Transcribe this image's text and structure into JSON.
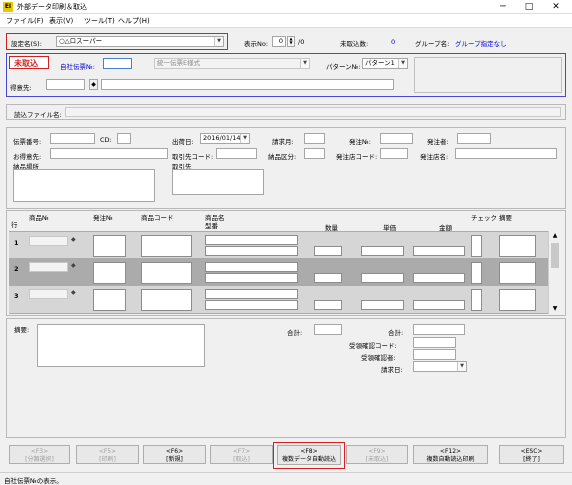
{
  "window": {
    "title": "外部データ印刷＆取込",
    "app_icon": "EI",
    "controls": [
      "─",
      "□",
      "✕"
    ]
  },
  "menu": [
    "ファイル(F)",
    "表示(V)",
    "ツール(T)",
    "ヘルプ(H)"
  ],
  "header": {
    "setting_label": "設定名(S):",
    "setting_value": "○△ロスーパー",
    "display_no_label": "表示No:",
    "display_no_value": "0",
    "display_no_total": "/0",
    "not_imported_label": "未取込数:",
    "not_imported_value": "0",
    "group_label": "グループ名:",
    "group_value": "グループ指定なし"
  },
  "upper": {
    "status_badge": "未取込",
    "slip_no_label": "自社伝票№:",
    "slip_no_value": "",
    "slip_format": "統一伝票E様式",
    "pattern_label": "パターン№:",
    "pattern_value": "パターン1",
    "customer_label": "得意先:"
  },
  "file_label": "読込ファイル名:",
  "form": {
    "slip_number": "伝票番号:",
    "cd": "CD:",
    "ship_date_label": "出荷日:",
    "ship_date_value": "2016/01/14",
    "billing_month": "請求月:",
    "order_no": "発注№:",
    "orderer": "発注者:",
    "customer2": "お得意先:",
    "trade_code": "取引先コード:",
    "delivery_class": "納品区分:",
    "order_store_code": "発注店コード:",
    "order_store_name": "発注店名:",
    "delivery_place": "納品場所",
    "trade_partner": "取引先"
  },
  "grid": {
    "row_header": "行",
    "headers": {
      "product_no": "商品№",
      "order_no": "発注№",
      "product_code": "商品コード",
      "product_name": "商品名",
      "model": "型番",
      "quantity": "数量",
      "unit_price": "単価",
      "amount": "金額",
      "check": "チェック",
      "remarks": "摘要"
    },
    "rows": [
      "1",
      "2",
      "3"
    ]
  },
  "bottom": {
    "remarks_label": "摘要:",
    "total_label": "合計:",
    "total2_label": "合計:",
    "confirm_code_label": "受領確認コード:",
    "confirmer_label": "受領確認者:",
    "billing_date_label": "請求日:"
  },
  "buttons": [
    {
      "key": "<F3>",
      "label": "[分類選択]",
      "enabled": false
    },
    {
      "key": "<F5>",
      "label": "[印刷]",
      "enabled": false
    },
    {
      "key": "<F6>",
      "label": "[新規]",
      "enabled": true
    },
    {
      "key": "<F7>",
      "label": "[取込]",
      "enabled": false
    },
    {
      "key": "<F8>",
      "label": "複数データ自動読込",
      "enabled": true
    },
    {
      "key": "<F9>",
      "label": "[未取込]",
      "enabled": false
    },
    {
      "key": "<F12>",
      "label": "複数自動読込印刷",
      "enabled": true
    },
    {
      "key": "<ESC>",
      "label": "[終了]",
      "enabled": true
    }
  ],
  "status": "自社伝票№の表示。"
}
